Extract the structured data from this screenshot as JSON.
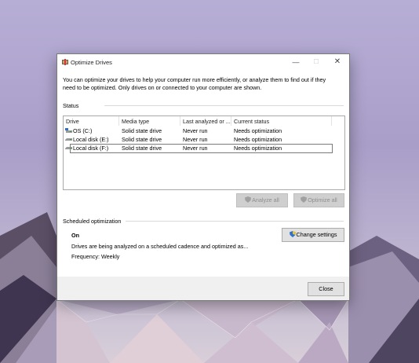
{
  "window": {
    "title": "Optimize Drives",
    "minimize_glyph": "—",
    "maximize_glyph": "☐",
    "close_glyph": "✕"
  },
  "description": "You can optimize your drives to help your computer run more efficiently, or analyze them to find out if they need to be optimized. Only drives on or connected to your computer are shown.",
  "status": {
    "label": "Status",
    "columns": [
      "Drive",
      "Media type",
      "Last analyzed or ...",
      "Current status"
    ],
    "drives": [
      {
        "icon": "os-drive-icon",
        "name": "OS (C:)",
        "media": "Solid state drive",
        "last": "Never run",
        "status": "Needs optimization"
      },
      {
        "icon": "disk-drive-icon",
        "name": "Local disk (E:)",
        "media": "Solid state drive",
        "last": "Never run",
        "status": "Needs optimization"
      },
      {
        "icon": "disk-drive-icon",
        "name": "Local disk (F:)",
        "media": "Solid state drive",
        "last": "Never run",
        "status": "Needs optimization"
      }
    ],
    "selected_index": 2,
    "analyze_button": "Analyze all",
    "optimize_button": "Optimize all"
  },
  "scheduled": {
    "label": "Scheduled optimization",
    "state": "On",
    "description": "Drives are being analyzed on a scheduled cadence and optimized as...",
    "frequency": "Frequency: Weekly",
    "change_button": "Change settings"
  },
  "close_button": "Close",
  "colors": {
    "shield_blue": "#2f6fd0",
    "shield_yellow": "#e8c23a"
  }
}
